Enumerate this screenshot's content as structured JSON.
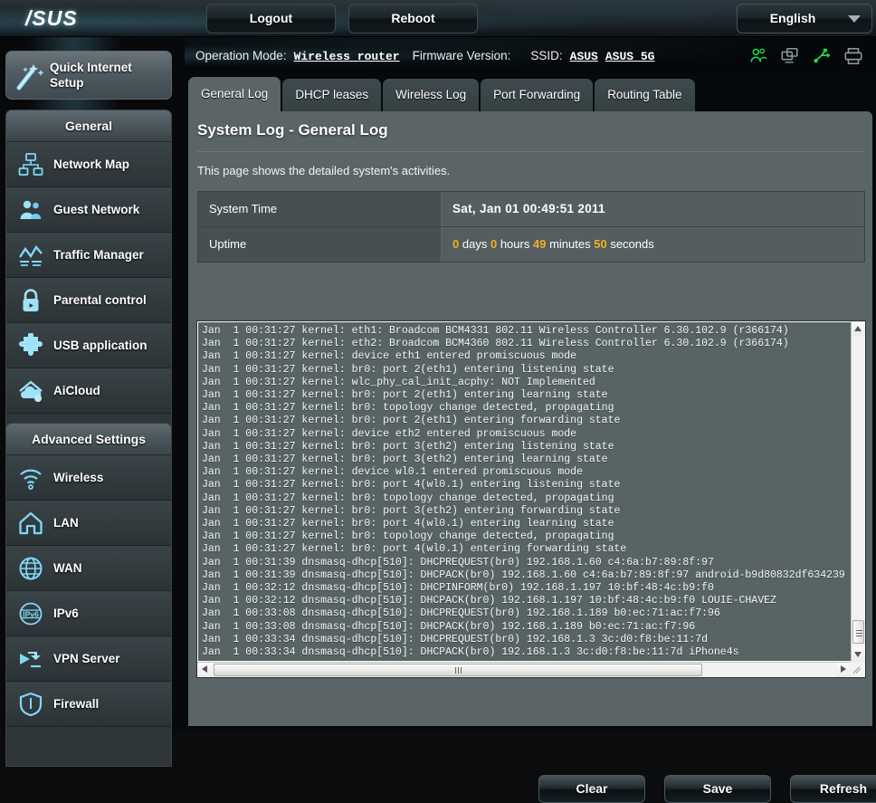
{
  "topbar": {
    "logo": "/SUS",
    "logout_label": "Logout",
    "reboot_label": "Reboot",
    "language": "English"
  },
  "infobar": {
    "operation_mode_label": "Operation Mode:",
    "operation_mode_value": "Wireless router",
    "firmware_label": "Firmware Version:",
    "firmware_value": "",
    "ssid_label": "SSID:",
    "ssid_value_1": "ASUS",
    "ssid_value_2": "ASUS_5G",
    "status_icons": [
      {
        "name": "guest-network-icon",
        "color": "#23d84a"
      },
      {
        "name": "network-clone-icon",
        "color": "#8b9aa0"
      },
      {
        "name": "usb-icon",
        "color": "#23d84a"
      },
      {
        "name": "printer-icon",
        "color": "#8b9aa0"
      }
    ]
  },
  "sidebar": {
    "quick_internet_setup": "Quick Internet Setup",
    "general": {
      "header": "General",
      "items": [
        {
          "label": "Network Map",
          "icon": "network-map-icon"
        },
        {
          "label": "Guest Network",
          "icon": "guest-network-icon"
        },
        {
          "label": "Traffic Manager",
          "icon": "traffic-manager-icon"
        },
        {
          "label": "Parental control",
          "icon": "lock-icon"
        },
        {
          "label": "USB application",
          "icon": "puzzle-icon"
        },
        {
          "label": "AiCloud",
          "icon": "cloud-icon"
        }
      ]
    },
    "advanced": {
      "header": "Advanced Settings",
      "items": [
        {
          "label": "Wireless",
          "icon": "wifi-icon"
        },
        {
          "label": "LAN",
          "icon": "home-icon"
        },
        {
          "label": "WAN",
          "icon": "globe-icon"
        },
        {
          "label": "IPv6",
          "icon": "ipv6-globe-icon"
        },
        {
          "label": "VPN Server",
          "icon": "vpn-icon"
        },
        {
          "label": "Firewall",
          "icon": "shield-icon"
        }
      ]
    }
  },
  "tabs": [
    {
      "label": "General Log",
      "active": true
    },
    {
      "label": "DHCP leases",
      "active": false
    },
    {
      "label": "Wireless Log",
      "active": false
    },
    {
      "label": "Port Forwarding",
      "active": false
    },
    {
      "label": "Routing Table",
      "active": false
    }
  ],
  "page": {
    "title": "System Log - General Log",
    "description": "This page shows the detailed system's activities."
  },
  "info_table": {
    "system_time_label": "System Time",
    "system_time_value": "Sat, Jan 01  00:49:51  2011",
    "uptime_label": "Uptime",
    "uptime": {
      "days": "0",
      "days_unit": "days",
      "hours": "0",
      "hours_unit": "hours",
      "minutes": "49",
      "minutes_unit": "minutes",
      "seconds": "50",
      "seconds_unit": "seconds"
    }
  },
  "log": {
    "lines": [
      "Jan  1 00:31:27 kernel: eth1: Broadcom BCM4331 802.11 Wireless Controller 6.30.102.9 (r366174)",
      "Jan  1 00:31:27 kernel: eth2: Broadcom BCM4360 802.11 Wireless Controller 6.30.102.9 (r366174)",
      "Jan  1 00:31:27 kernel: device eth1 entered promiscuous mode",
      "Jan  1 00:31:27 kernel: br0: port 2(eth1) entering listening state",
      "Jan  1 00:31:27 kernel: wlc_phy_cal_init_acphy: NOT Implemented",
      "Jan  1 00:31:27 kernel: br0: port 2(eth1) entering learning state",
      "Jan  1 00:31:27 kernel: br0: topology change detected, propagating",
      "Jan  1 00:31:27 kernel: br0: port 2(eth1) entering forwarding state",
      "Jan  1 00:31:27 kernel: device eth2 entered promiscuous mode",
      "Jan  1 00:31:27 kernel: br0: port 3(eth2) entering listening state",
      "Jan  1 00:31:27 kernel: br0: port 3(eth2) entering learning state",
      "Jan  1 00:31:27 kernel: device wl0.1 entered promiscuous mode",
      "Jan  1 00:31:27 kernel: br0: port 4(wl0.1) entering listening state",
      "Jan  1 00:31:27 kernel: br0: topology change detected, propagating",
      "Jan  1 00:31:27 kernel: br0: port 3(eth2) entering forwarding state",
      "Jan  1 00:31:27 kernel: br0: port 4(wl0.1) entering learning state",
      "Jan  1 00:31:27 kernel: br0: topology change detected, propagating",
      "Jan  1 00:31:27 kernel: br0: port 4(wl0.1) entering forwarding state",
      "Jan  1 00:31:39 dnsmasq-dhcp[510]: DHCPREQUEST(br0) 192.168.1.60 c4:6a:b7:89:8f:97",
      "Jan  1 00:31:39 dnsmasq-dhcp[510]: DHCPACK(br0) 192.168.1.60 c4:6a:b7:89:8f:97 android-b9d80832df634239",
      "Jan  1 00:32:12 dnsmasq-dhcp[510]: DHCPINFORM(br0) 192.168.1.197 10:bf:48:4c:b9:f0",
      "Jan  1 00:32:12 dnsmasq-dhcp[510]: DHCPACK(br0) 192.168.1.197 10:bf:48:4c:b9:f0 LOUIE-CHAVEZ",
      "Jan  1 00:33:08 dnsmasq-dhcp[510]: DHCPREQUEST(br0) 192.168.1.189 b0:ec:71:ac:f7:96",
      "Jan  1 00:33:08 dnsmasq-dhcp[510]: DHCPACK(br0) 192.168.1.189 b0:ec:71:ac:f7:96",
      "Jan  1 00:33:34 dnsmasq-dhcp[510]: DHCPREQUEST(br0) 192.168.1.3 3c:d0:f8:be:11:7d",
      "Jan  1 00:33:34 dnsmasq-dhcp[510]: DHCPACK(br0) 192.168.1.3 3c:d0:f8:be:11:7d iPhone4s"
    ]
  },
  "actions": {
    "clear_label": "Clear",
    "save_label": "Save",
    "refresh_label": "Refresh"
  },
  "colors": {
    "accent_cyan": "#7fd8f5",
    "status_green": "#23d84a",
    "uptime_number": "#f0b020",
    "panel_bg": "#5b6567",
    "log_bg": "#586366"
  }
}
